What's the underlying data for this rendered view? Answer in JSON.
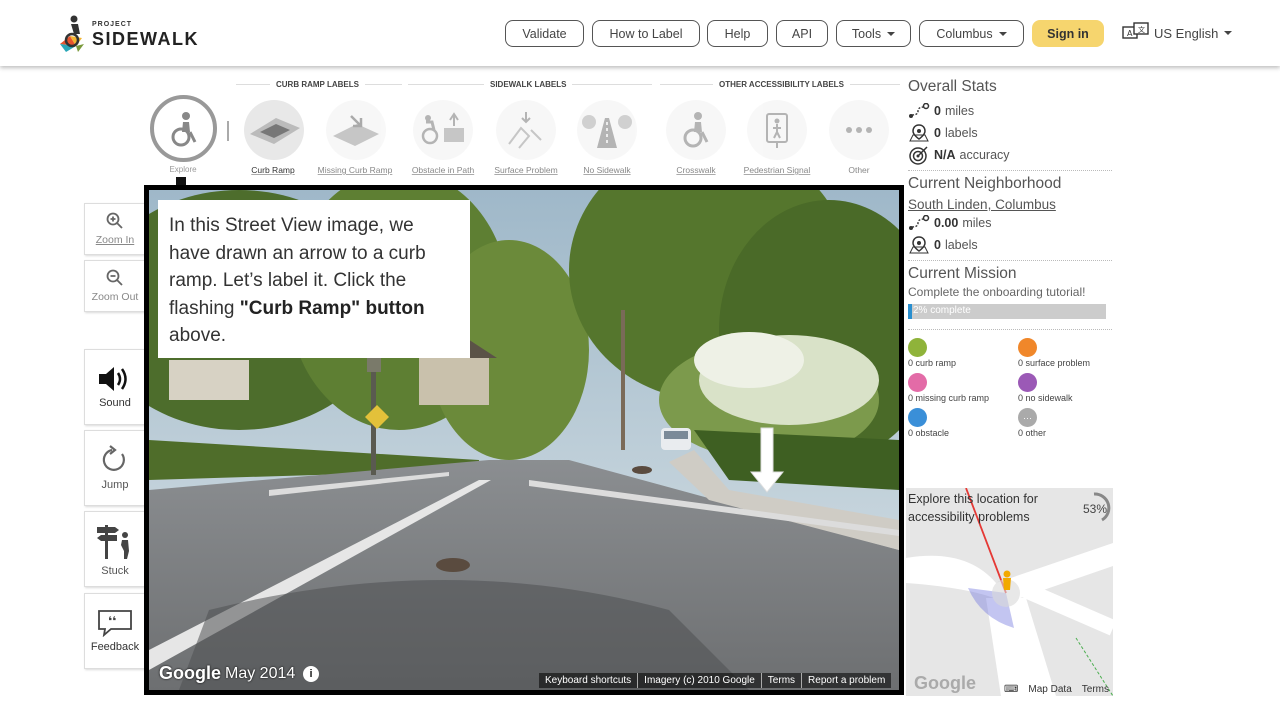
{
  "header": {
    "logo_small": "PROJECT",
    "logo_big": "SIDEWALK",
    "nav": [
      {
        "label": "Validate"
      },
      {
        "label": "How to Label"
      },
      {
        "label": "Help"
      },
      {
        "label": "API"
      },
      {
        "label": "Tools"
      },
      {
        "label": "Columbus"
      }
    ],
    "signin_label": "Sign in",
    "language_label": "US English"
  },
  "toolbar": {
    "section_curb": "CURB RAMP LABELS",
    "section_sidewalk": "SIDEWALK LABELS",
    "section_other": "OTHER ACCESSIBILITY LABELS",
    "explore_label": "Explore",
    "tools": [
      {
        "label": "Curb Ramp",
        "icon": "curb-ramp-icon"
      },
      {
        "label": "Missing Curb Ramp",
        "icon": "missing-curb-ramp-icon"
      },
      {
        "label": "Obstacle in Path",
        "icon": "obstacle-icon"
      },
      {
        "label": "Surface Problem",
        "icon": "surface-problem-icon"
      },
      {
        "label": "No Sidewalk",
        "icon": "no-sidewalk-icon"
      },
      {
        "label": "Crosswalk",
        "icon": "crosswalk-icon"
      },
      {
        "label": "Pedestrian Signal",
        "icon": "pedestrian-signal-icon"
      },
      {
        "label": "Other",
        "icon": "other-icon"
      }
    ]
  },
  "sidebar": {
    "zoom_in": "Zoom In",
    "zoom_out": "Zoom Out",
    "sound": "Sound",
    "jump": "Jump",
    "stuck": "Stuck",
    "feedback": "Feedback"
  },
  "streetview": {
    "tip_text_1": "In this Street View image, we have drawn an arrow to a curb ramp. Let’s label it. Click the flashing ",
    "tip_bold": "\"Curb Ramp\" button",
    "tip_text_2": " above.",
    "google": "Google",
    "date": "May 2014",
    "footer": [
      "Keyboard shortcuts",
      "Imagery (c) 2010 Google",
      "Terms",
      "Report a problem"
    ]
  },
  "stats": {
    "overall_title": "Overall Stats",
    "miles_value": "0",
    "miles_unit": "miles",
    "labels_value": "0",
    "labels_unit": "labels",
    "accuracy_value": "N/A",
    "accuracy_unit": "accuracy",
    "neighborhood_title": "Current Neighborhood",
    "neighborhood_name": "South Linden, Columbus",
    "nb_miles_value": "0.00",
    "nb_miles_unit": "miles",
    "nb_labels_value": "0",
    "nb_labels_unit": "labels",
    "mission_title": "Current Mission",
    "mission_desc": "Complete the onboarding tutorial!",
    "progress_text": "2% complete",
    "progress_fraction": 0.02,
    "counts": [
      {
        "text": "0 curb ramp",
        "color": "#8fb33a"
      },
      {
        "text": "0 surface problem",
        "color": "#f0872a"
      },
      {
        "text": "0 missing curb ramp",
        "color": "#e36ba7"
      },
      {
        "text": "0 no sidewalk",
        "color": "#9b59b6"
      },
      {
        "text": "0 obstacle",
        "color": "#3a8fd8"
      },
      {
        "text": "0 other",
        "color": "#aaaaaa"
      }
    ]
  },
  "minimap": {
    "explore_text": "Explore this location for accessibility problems",
    "percent": "53%",
    "google": "Google",
    "footer": [
      "Map Data",
      "Terms"
    ]
  }
}
